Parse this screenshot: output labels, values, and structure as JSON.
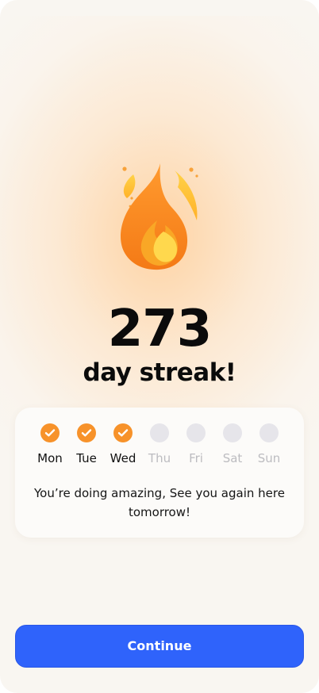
{
  "streak": {
    "count": "273",
    "label": "day streak!",
    "icon": "flame-icon"
  },
  "week": {
    "days": [
      {
        "label": "Mon",
        "completed": true
      },
      {
        "label": "Tue",
        "completed": true
      },
      {
        "label": "Wed",
        "completed": true
      },
      {
        "label": "Thu",
        "completed": false
      },
      {
        "label": "Fri",
        "completed": false
      },
      {
        "label": "Sat",
        "completed": false
      },
      {
        "label": "Sun",
        "completed": false
      }
    ],
    "message": "You’re doing amazing, See you again here tomorrow!"
  },
  "actions": {
    "continue_label": "Continue"
  },
  "colors": {
    "accent": "#2f63fb",
    "streak_orange": "#f7922a",
    "inactive_day": "#e6e5ea"
  }
}
